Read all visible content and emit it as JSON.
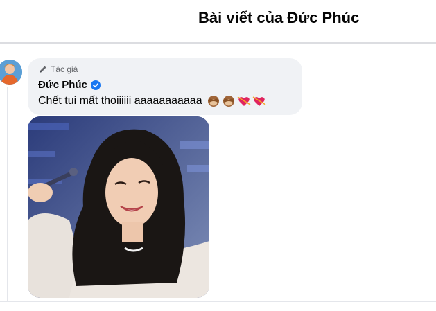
{
  "header": {
    "title": "Bài viết của Đức Phúc"
  },
  "comment": {
    "author_badge": "Tác giả",
    "author_name": "Đức Phúc",
    "text": "Chết tui mất thoiiiiii aaaaaaaaaaa",
    "emojis": [
      "see-no-evil-monkey",
      "see-no-evil-monkey",
      "heart-with-arrow",
      "heart-with-arrow"
    ]
  },
  "colors": {
    "bubble_bg": "#f0f2f5",
    "verified_blue": "#1877f2",
    "secondary_text": "#65676b",
    "divider": "#dcdde1"
  }
}
